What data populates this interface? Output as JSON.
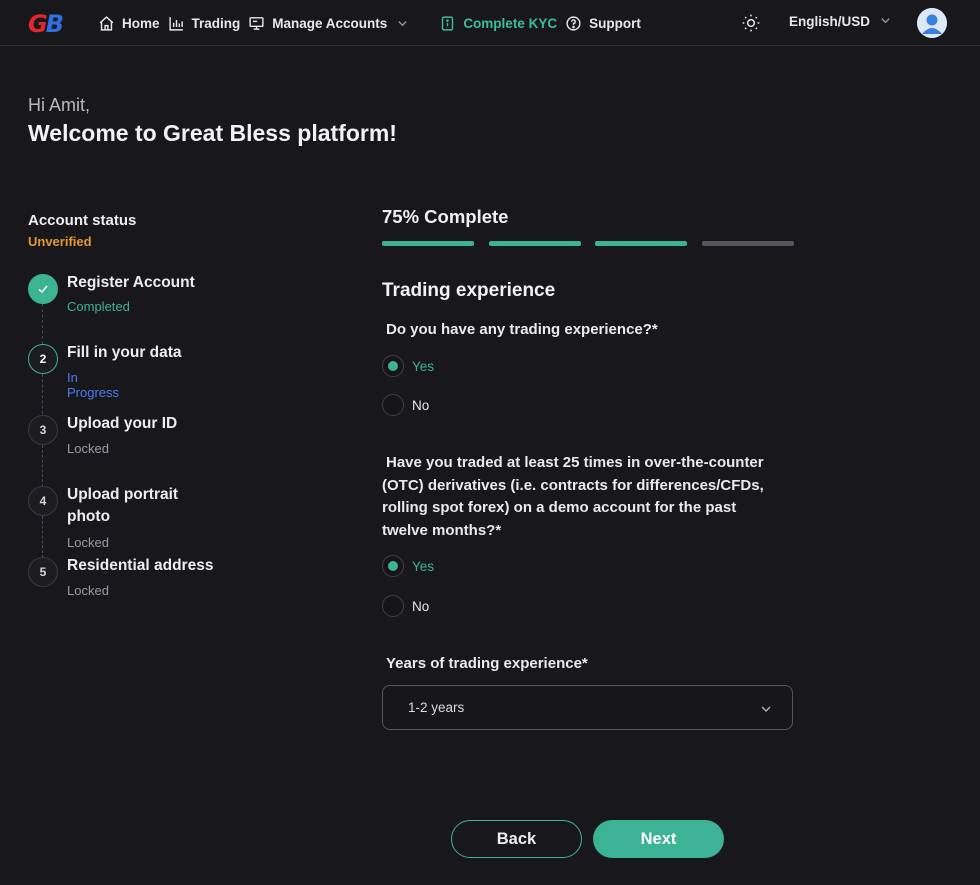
{
  "header": {
    "logo": "GB",
    "nav": [
      {
        "label": "Home",
        "icon": "home-icon"
      },
      {
        "label": "Trading",
        "icon": "chart-icon"
      },
      {
        "label": "Manage Accounts",
        "icon": "monitor-icon"
      },
      {
        "label": "Complete KYC",
        "icon": "document-icon"
      },
      {
        "label": "Support",
        "icon": "help-circle-icon"
      }
    ],
    "language": "English/USD"
  },
  "greeting": {
    "hi": "Hi Amit,",
    "welcome": "Welcome to Great Bless platform!"
  },
  "sidebar": {
    "status_label": "Account status",
    "status_value": "Unverified",
    "steps": [
      {
        "num": "",
        "title": "Register Account",
        "status": "Completed"
      },
      {
        "num": "2",
        "title": "Fill in your data",
        "status": "In Progress"
      },
      {
        "num": "3",
        "title": "Upload your ID",
        "status": "Locked"
      },
      {
        "num": "4",
        "title": "Upload portrait photo",
        "status": "Locked"
      },
      {
        "num": "5",
        "title": "Residential address",
        "status": "Locked"
      }
    ]
  },
  "progress": {
    "label": "75% Complete",
    "value": 0.75,
    "segments_total": 4,
    "segments_done": 3
  },
  "form": {
    "section_title": "Trading experience",
    "q1": {
      "text": "Do you have any trading experience?*",
      "options": [
        "Yes",
        "No"
      ],
      "selected": "Yes"
    },
    "q2": {
      "text": "Have you traded at least 25 times in over-the-counter (OTC) derivatives (i.e. contracts for differences/CFDs, rolling spot forex) on a demo account for the past twelve months?*",
      "options": [
        "Yes",
        "No"
      ],
      "selected": "Yes"
    },
    "q3": {
      "text": "Years of trading experience*",
      "value": "1-2 years"
    }
  },
  "actions": {
    "back": "Back",
    "next": "Next"
  },
  "colors": {
    "accent": "#3bb394",
    "warning": "#e39a2c",
    "in_progress": "#4a7ff0",
    "background": "#18181c"
  }
}
